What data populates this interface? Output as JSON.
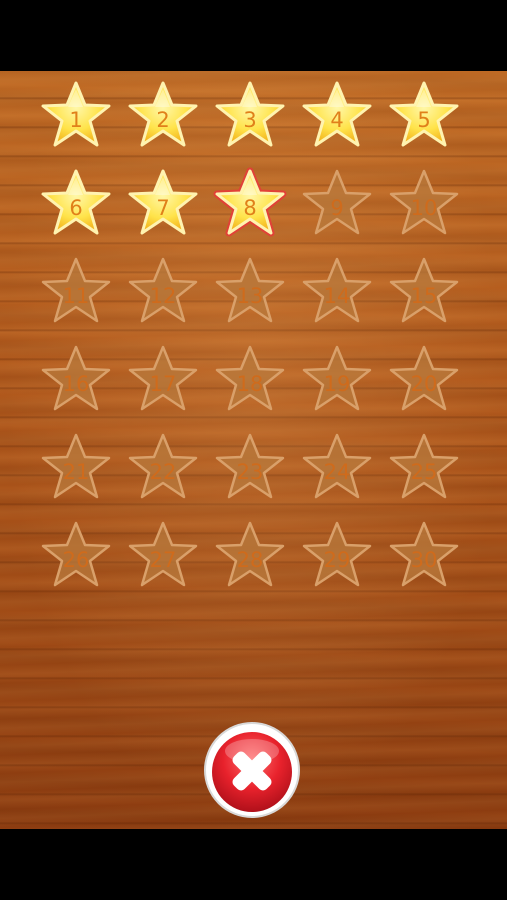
{
  "levels": [
    {
      "label": "1",
      "state": "unlocked"
    },
    {
      "label": "2",
      "state": "unlocked"
    },
    {
      "label": "3",
      "state": "unlocked"
    },
    {
      "label": "4",
      "state": "unlocked"
    },
    {
      "label": "5",
      "state": "unlocked"
    },
    {
      "label": "6",
      "state": "unlocked"
    },
    {
      "label": "7",
      "state": "unlocked"
    },
    {
      "label": "8",
      "state": "current"
    },
    {
      "label": "9",
      "state": "locked"
    },
    {
      "label": "10",
      "state": "locked"
    },
    {
      "label": "11",
      "state": "locked"
    },
    {
      "label": "12",
      "state": "locked"
    },
    {
      "label": "13",
      "state": "locked"
    },
    {
      "label": "14",
      "state": "locked"
    },
    {
      "label": "15",
      "state": "locked"
    },
    {
      "label": "16",
      "state": "locked"
    },
    {
      "label": "17",
      "state": "locked"
    },
    {
      "label": "18",
      "state": "locked"
    },
    {
      "label": "19",
      "state": "locked"
    },
    {
      "label": "20",
      "state": "locked"
    },
    {
      "label": "21",
      "state": "locked"
    },
    {
      "label": "22",
      "state": "locked"
    },
    {
      "label": "23",
      "state": "locked"
    },
    {
      "label": "24",
      "state": "locked"
    },
    {
      "label": "25",
      "state": "locked"
    },
    {
      "label": "26",
      "state": "locked"
    },
    {
      "label": "27",
      "state": "locked"
    },
    {
      "label": "28",
      "state": "locked"
    },
    {
      "label": "29",
      "state": "locked"
    },
    {
      "label": "30",
      "state": "locked"
    }
  ],
  "close_button": {
    "icon": "close-x-icon",
    "color": "#e8222c"
  },
  "colors": {
    "star_unlocked": "#ffe34a",
    "star_locked": "#b87a3c",
    "current_highlight": "#e83a3a",
    "wood": "#b2591c",
    "number": "#e0801a"
  }
}
